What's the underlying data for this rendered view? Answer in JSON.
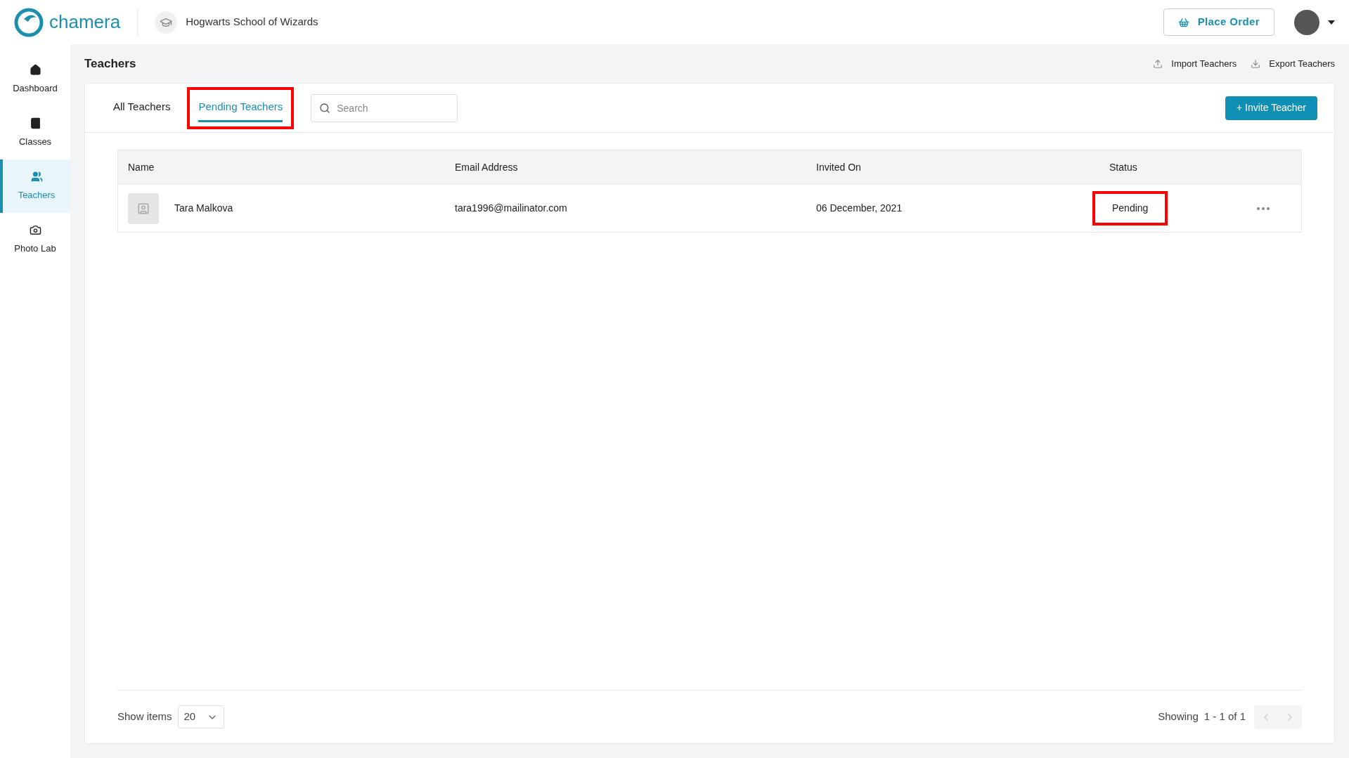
{
  "header": {
    "brand": "chamera",
    "school": "Hogwarts School of Wizards",
    "place_order": "Place Order"
  },
  "sidebar": {
    "items": [
      {
        "label": "Dashboard",
        "kind": "home",
        "selected": false
      },
      {
        "label": "Classes",
        "kind": "book",
        "selected": false
      },
      {
        "label": "Teachers",
        "kind": "people",
        "selected": true
      },
      {
        "label": "Photo Lab",
        "kind": "camera",
        "selected": false
      }
    ]
  },
  "page": {
    "title": "Teachers",
    "actions": [
      {
        "label": "Import Teachers",
        "kind": "upload"
      },
      {
        "label": "Export Teachers",
        "kind": "download"
      }
    ]
  },
  "tabs": [
    {
      "label": "All Teachers",
      "selected": false,
      "highlighted": false
    },
    {
      "label": "Pending Teachers",
      "selected": true,
      "highlighted": true
    }
  ],
  "search": {
    "placeholder": "Search"
  },
  "invite_button": "+ Invite Teacher",
  "table": {
    "columns": [
      "Name",
      "Email Address",
      "Invited On",
      "Status"
    ],
    "rows": [
      {
        "name": "Tara Malkova",
        "email": "tara1996@mailinator.com",
        "invited_on": "06 December, 2021",
        "status": "Pending",
        "status_highlighted": true
      }
    ]
  },
  "footer": {
    "show_items_label": "Show items",
    "page_size": "20",
    "showing_label": "Showing",
    "range": "1 - 1 of 1"
  }
}
